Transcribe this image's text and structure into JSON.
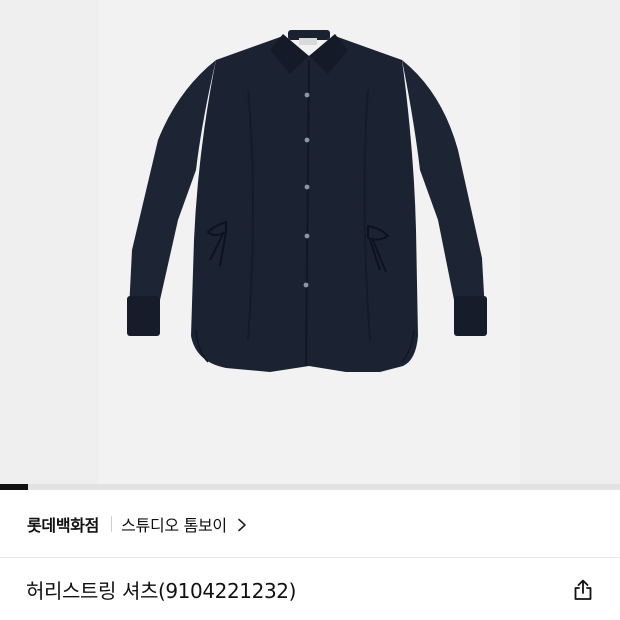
{
  "gallery": {
    "image_alt": "허리스트링 셔츠",
    "garment_color": "#1a2130",
    "slide_progress": 0.045
  },
  "brand": {
    "store": "롯데백화점",
    "name": "스튜디오 톰보이"
  },
  "product": {
    "title": "허리스트링 셔츠(9104221232)"
  },
  "icons": {
    "brand_link": "chevron-right-icon",
    "share": "share-icon"
  }
}
